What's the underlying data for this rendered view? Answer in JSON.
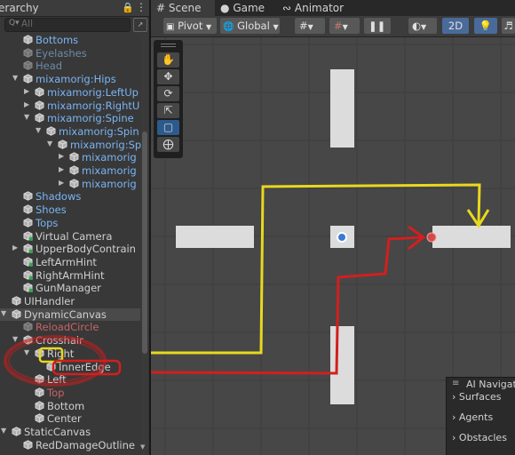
{
  "hierarchy": {
    "tab_title": "erarchy",
    "search_placeholder": "All",
    "items": [
      {
        "label": "Bottoms",
        "color": "blue",
        "indent": 1,
        "arrow": false,
        "icon": "cube"
      },
      {
        "label": "Eyelashes",
        "color": "grey",
        "indent": 1,
        "arrow": false,
        "icon": "cube-grey"
      },
      {
        "label": "Head",
        "color": "grey",
        "indent": 1,
        "arrow": false,
        "icon": "cube-grey"
      },
      {
        "label": "mixamorig:Hips",
        "color": "blue",
        "indent": 1,
        "arrow": "down",
        "icon": "cube"
      },
      {
        "label": "mixamorig:LeftUp",
        "color": "blue",
        "indent": 2,
        "arrow": "right",
        "icon": "cube"
      },
      {
        "label": "mixamorig:RightU",
        "color": "blue",
        "indent": 2,
        "arrow": "right",
        "icon": "cube"
      },
      {
        "label": "mixamorig:Spine",
        "color": "blue",
        "indent": 2,
        "arrow": "down",
        "icon": "cube"
      },
      {
        "label": "mixamorig:Spin",
        "color": "blue",
        "indent": 3,
        "arrow": "down",
        "icon": "cube"
      },
      {
        "label": "mixamorig:Sp",
        "color": "blue",
        "indent": 4,
        "arrow": "down",
        "icon": "cube"
      },
      {
        "label": "mixamorig",
        "color": "blue",
        "indent": 5,
        "arrow": "right",
        "icon": "cube"
      },
      {
        "label": "mixamorig",
        "color": "blue",
        "indent": 5,
        "arrow": "right",
        "icon": "cube"
      },
      {
        "label": "mixamorig",
        "color": "blue",
        "indent": 5,
        "arrow": "right",
        "icon": "cube"
      },
      {
        "label": "Shadows",
        "color": "blue",
        "indent": 1,
        "arrow": false,
        "icon": "cube"
      },
      {
        "label": "Shoes",
        "color": "blue",
        "indent": 1,
        "arrow": false,
        "icon": "cube"
      },
      {
        "label": "Tops",
        "color": "blue",
        "indent": 1,
        "arrow": false,
        "icon": "cube"
      },
      {
        "label": "Virtual Camera",
        "color": "wht",
        "indent": 1,
        "arrow": false,
        "icon": "cube-green"
      },
      {
        "label": "UpperBodyContrain",
        "color": "wht",
        "indent": 1,
        "arrow": "right",
        "icon": "cube-green"
      },
      {
        "label": "LeftArmHint",
        "color": "wht",
        "indent": 1,
        "arrow": false,
        "icon": "cube-green"
      },
      {
        "label": "RightArmHint",
        "color": "wht",
        "indent": 1,
        "arrow": false,
        "icon": "cube-green"
      },
      {
        "label": "GunManager",
        "color": "wht",
        "indent": 1,
        "arrow": false,
        "icon": "cube-green"
      },
      {
        "label": "UIHandler",
        "color": "wht",
        "indent": 0,
        "arrow": false,
        "icon": "cube"
      },
      {
        "label": "DynamicCanvas",
        "color": "wht",
        "indent": 0,
        "arrow": "down",
        "icon": "cube",
        "selected": true
      },
      {
        "label": "ReloadCircle",
        "color": "pink",
        "indent": 1,
        "arrow": false,
        "icon": "cube-grey"
      },
      {
        "label": "Crosshair",
        "color": "wht",
        "indent": 1,
        "arrow": "down",
        "icon": "cube"
      },
      {
        "label": "Right",
        "color": "wht",
        "indent": 2,
        "arrow": "down",
        "icon": "cube"
      },
      {
        "label": "InnerEdge",
        "color": "wht",
        "indent": 3,
        "arrow": false,
        "icon": "cube"
      },
      {
        "label": "Left",
        "color": "wht",
        "indent": 2,
        "arrow": false,
        "icon": "cube"
      },
      {
        "label": "Top",
        "color": "pink",
        "indent": 2,
        "arrow": false,
        "icon": "cube"
      },
      {
        "label": "Bottom",
        "color": "wht",
        "indent": 2,
        "arrow": false,
        "icon": "cube"
      },
      {
        "label": "Center",
        "color": "wht",
        "indent": 2,
        "arrow": false,
        "icon": "cube"
      },
      {
        "label": "StaticCanvas",
        "color": "wht",
        "indent": 0,
        "arrow": "down",
        "icon": "cube"
      },
      {
        "label": "RedDamageOutline",
        "color": "wht",
        "indent": 1,
        "arrow": false,
        "icon": "cube"
      }
    ]
  },
  "scene_tabs": [
    {
      "label": "Scene",
      "icon": "hash-icon",
      "active": true
    },
    {
      "label": "Game",
      "icon": "gamepad-icon",
      "active": false
    },
    {
      "label": "Animator",
      "icon": "animator-icon",
      "active": false
    }
  ],
  "toolbar": {
    "pivot_label": "Pivot",
    "global_label": "Global",
    "mode_2d": "2D"
  },
  "nav_panel": {
    "title": "AI Navigat",
    "items": [
      "Surfaces",
      "Agents",
      "Obstacles"
    ]
  },
  "colors": {
    "annotation_yellow": "#e8d81e",
    "annotation_red": "#d41e1e",
    "selection_blue": "#2d5a8c"
  }
}
